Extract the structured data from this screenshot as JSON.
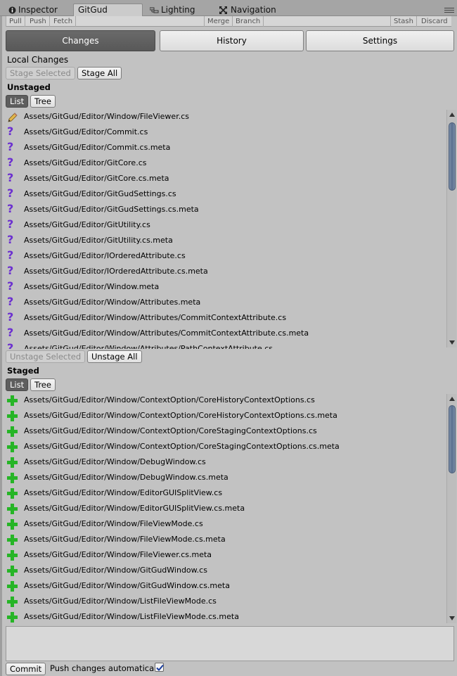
{
  "tabs": [
    {
      "label": "Inspector",
      "icon": "info-icon"
    },
    {
      "label": "GitGud",
      "icon": ""
    },
    {
      "label": "Lighting",
      "icon": "lighting-icon"
    },
    {
      "label": "Navigation",
      "icon": "navigation-icon"
    }
  ],
  "toolbar": {
    "pull": "Pull",
    "push": "Push",
    "fetch": "Fetch",
    "merge": "Merge",
    "branch": "Branch",
    "stash": "Stash",
    "discard": "Discard"
  },
  "modes": {
    "changes": "Changes",
    "history": "History",
    "settings": "Settings",
    "active": "Changes"
  },
  "local_changes_title": "Local Changes",
  "unstaged": {
    "stage_selected": "Stage Selected",
    "stage_all": "Stage All",
    "title": "Unstaged",
    "list_label": "List",
    "tree_label": "Tree",
    "files": [
      {
        "status": "modified",
        "path": "Assets/GitGud/Editor/Window/FileViewer.cs"
      },
      {
        "status": "untracked",
        "path": "Assets/GitGud/Editor/Commit.cs"
      },
      {
        "status": "untracked",
        "path": "Assets/GitGud/Editor/Commit.cs.meta"
      },
      {
        "status": "untracked",
        "path": "Assets/GitGud/Editor/GitCore.cs"
      },
      {
        "status": "untracked",
        "path": "Assets/GitGud/Editor/GitCore.cs.meta"
      },
      {
        "status": "untracked",
        "path": "Assets/GitGud/Editor/GitGudSettings.cs"
      },
      {
        "status": "untracked",
        "path": "Assets/GitGud/Editor/GitGudSettings.cs.meta"
      },
      {
        "status": "untracked",
        "path": "Assets/GitGud/Editor/GitUtility.cs"
      },
      {
        "status": "untracked",
        "path": "Assets/GitGud/Editor/GitUtility.cs.meta"
      },
      {
        "status": "untracked",
        "path": "Assets/GitGud/Editor/IOrderedAttribute.cs"
      },
      {
        "status": "untracked",
        "path": "Assets/GitGud/Editor/IOrderedAttribute.cs.meta"
      },
      {
        "status": "untracked",
        "path": "Assets/GitGud/Editor/Window.meta"
      },
      {
        "status": "untracked",
        "path": "Assets/GitGud/Editor/Window/Attributes.meta"
      },
      {
        "status": "untracked",
        "path": "Assets/GitGud/Editor/Window/Attributes/CommitContextAttribute.cs"
      },
      {
        "status": "untracked",
        "path": "Assets/GitGud/Editor/Window/Attributes/CommitContextAttribute.cs.meta"
      },
      {
        "status": "untracked",
        "path": "Assets/GitGud/Editor/Window/Attributes/PathContextAttribute.cs"
      }
    ]
  },
  "staged": {
    "unstage_selected": "Unstage Selected",
    "unstage_all": "Unstage All",
    "title": "Staged",
    "list_label": "List",
    "tree_label": "Tree",
    "files": [
      {
        "status": "added",
        "path": "Assets/GitGud/Editor/Window/ContextOption/CoreHistoryContextOptions.cs"
      },
      {
        "status": "added",
        "path": "Assets/GitGud/Editor/Window/ContextOption/CoreHistoryContextOptions.cs.meta"
      },
      {
        "status": "added",
        "path": "Assets/GitGud/Editor/Window/ContextOption/CoreStagingContextOptions.cs"
      },
      {
        "status": "added",
        "path": "Assets/GitGud/Editor/Window/ContextOption/CoreStagingContextOptions.cs.meta"
      },
      {
        "status": "added",
        "path": "Assets/GitGud/Editor/Window/DebugWindow.cs"
      },
      {
        "status": "added",
        "path": "Assets/GitGud/Editor/Window/DebugWindow.cs.meta"
      },
      {
        "status": "added",
        "path": "Assets/GitGud/Editor/Window/EditorGUISplitView.cs"
      },
      {
        "status": "added",
        "path": "Assets/GitGud/Editor/Window/EditorGUISplitView.cs.meta"
      },
      {
        "status": "added",
        "path": "Assets/GitGud/Editor/Window/FileViewMode.cs"
      },
      {
        "status": "added",
        "path": "Assets/GitGud/Editor/Window/FileViewMode.cs.meta"
      },
      {
        "status": "added",
        "path": "Assets/GitGud/Editor/Window/FileViewer.cs.meta"
      },
      {
        "status": "added",
        "path": "Assets/GitGud/Editor/Window/GitGudWindow.cs"
      },
      {
        "status": "added",
        "path": "Assets/GitGud/Editor/Window/GitGudWindow.cs.meta"
      },
      {
        "status": "added",
        "path": "Assets/GitGud/Editor/Window/ListFileViewMode.cs"
      },
      {
        "status": "added",
        "path": "Assets/GitGud/Editor/Window/ListFileViewMode.cs.meta"
      }
    ]
  },
  "commit": {
    "message": "",
    "button": "Commit",
    "push_label": "Push changes automatical",
    "push_auto_checked": true
  },
  "colors": {
    "accent": "#5e5e5e",
    "untracked": "#6b2fd0",
    "added": "#26b526",
    "scroll_thumb": "#5a6f8f"
  }
}
